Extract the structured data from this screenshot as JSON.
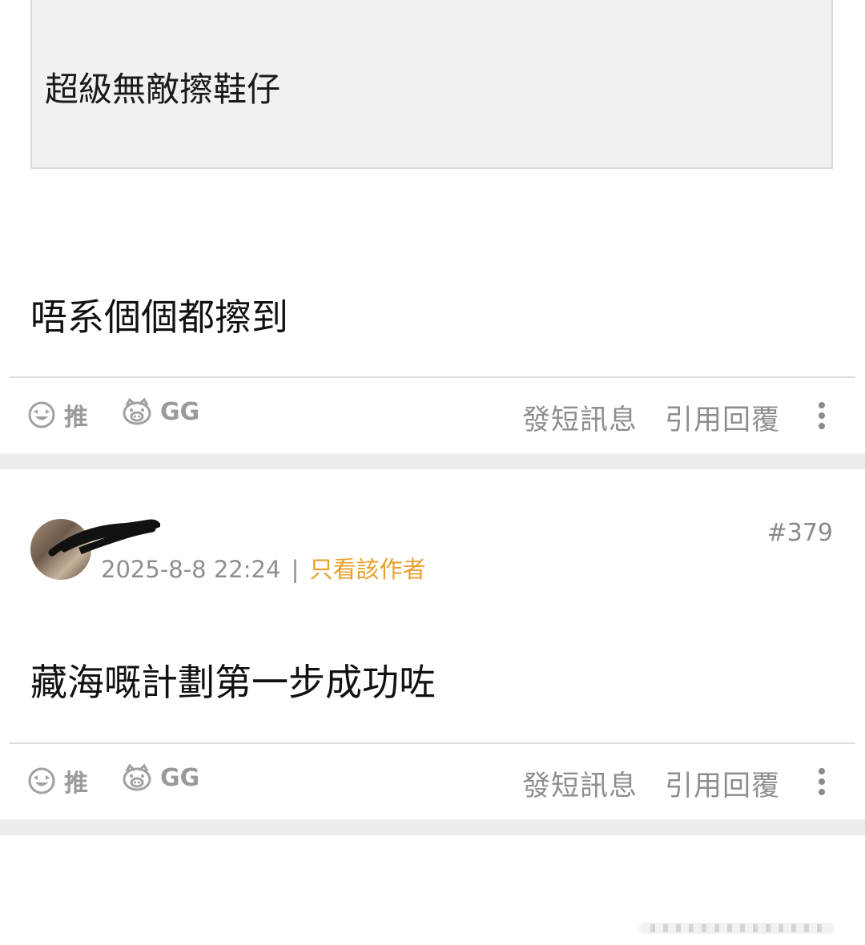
{
  "quoted_post": {
    "text": "超級無敵擦鞋仔"
  },
  "post1": {
    "body": "唔系個個都擦到",
    "actions": {
      "push_label": "推",
      "gg_label": "GG",
      "message_label": "發短訊息",
      "quote_reply_label": "引用回覆"
    }
  },
  "post2": {
    "number": "#379",
    "date": "2025-8-8 22:24",
    "separator": "|",
    "only_author_label": "只看該作者",
    "body": "藏海嘅計劃第一步成功咗",
    "actions": {
      "push_label": "推",
      "gg_label": "GG",
      "message_label": "發短訊息",
      "quote_reply_label": "引用回覆"
    }
  },
  "icons": {
    "push": "smile-face-icon",
    "gg": "pig-face-icon",
    "more": "more-vertical-icon"
  },
  "colors": {
    "accent": "#e8a02a",
    "muted": "#8e8e8e",
    "band": "#ededed"
  }
}
